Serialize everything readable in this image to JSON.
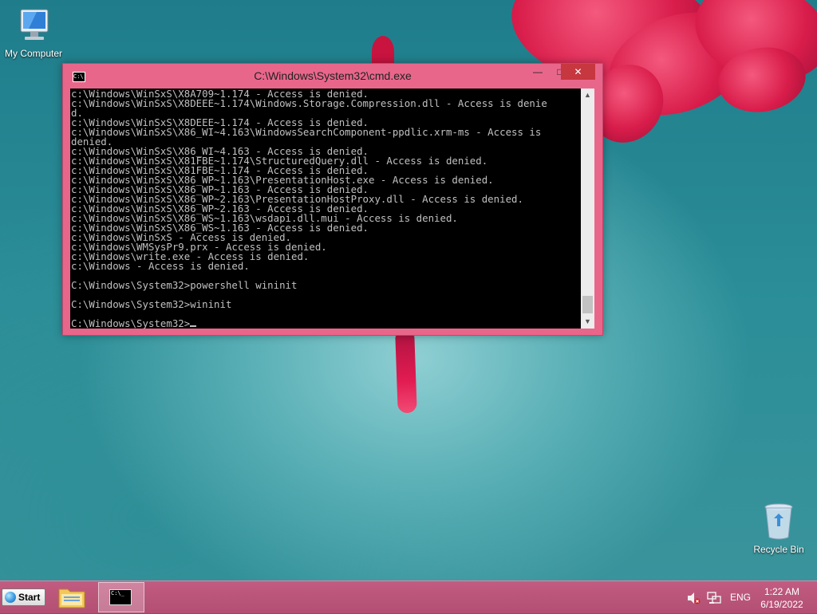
{
  "desktop": {
    "icons": [
      {
        "label": "My Computer",
        "icon": "computer-icon"
      },
      {
        "label": "Recycle Bin",
        "icon": "recycle-bin-icon"
      }
    ]
  },
  "window": {
    "title": "C:\\Windows\\System32\\cmd.exe",
    "minimize_label": "—",
    "maximize_label": "□",
    "close_label": "✕",
    "console_lines": [
      "c:\\Windows\\WinSxS\\X8A709~1.174 - Access is denied.",
      "c:\\Windows\\WinSxS\\X8DEEE~1.174\\Windows.Storage.Compression.dll - Access is denie",
      "d.",
      "c:\\Windows\\WinSxS\\X8DEEE~1.174 - Access is denied.",
      "c:\\Windows\\WinSxS\\X86_WI~4.163\\WindowsSearchComponent-ppdlic.xrm-ms - Access is",
      "denied.",
      "c:\\Windows\\WinSxS\\X86_WI~4.163 - Access is denied.",
      "c:\\Windows\\WinSxS\\X81FBE~1.174\\StructuredQuery.dll - Access is denied.",
      "c:\\Windows\\WinSxS\\X81FBE~1.174 - Access is denied.",
      "c:\\Windows\\WinSxS\\X86_WP~1.163\\PresentationHost.exe - Access is denied.",
      "c:\\Windows\\WinSxS\\X86_WP~1.163 - Access is denied.",
      "c:\\Windows\\WinSxS\\X86_WP~2.163\\PresentationHostProxy.dll - Access is denied.",
      "c:\\Windows\\WinSxS\\X86_WP~2.163 - Access is denied.",
      "c:\\Windows\\WinSxS\\X86_WS~1.163\\wsdapi.dll.mui - Access is denied.",
      "c:\\Windows\\WinSxS\\X86_WS~1.163 - Access is denied.",
      "c:\\Windows\\WinSxS - Access is denied.",
      "c:\\Windows\\WMSysPr9.prx - Access is denied.",
      "c:\\Windows\\write.exe - Access is denied.",
      "c:\\Windows - Access is denied.",
      "",
      "C:\\Windows\\System32>powershell wininit",
      "",
      "C:\\Windows\\System32>wininit",
      "",
      "C:\\Windows\\System32>"
    ]
  },
  "taskbar": {
    "start_label": "Start",
    "apps": [
      {
        "name": "File Explorer",
        "icon": "folder-icon"
      },
      {
        "name": "Command Prompt",
        "icon": "cmd-icon",
        "active": true
      }
    ],
    "tray": {
      "language": "ENG",
      "time": "1:22 AM",
      "date": "6/19/2022"
    }
  }
}
